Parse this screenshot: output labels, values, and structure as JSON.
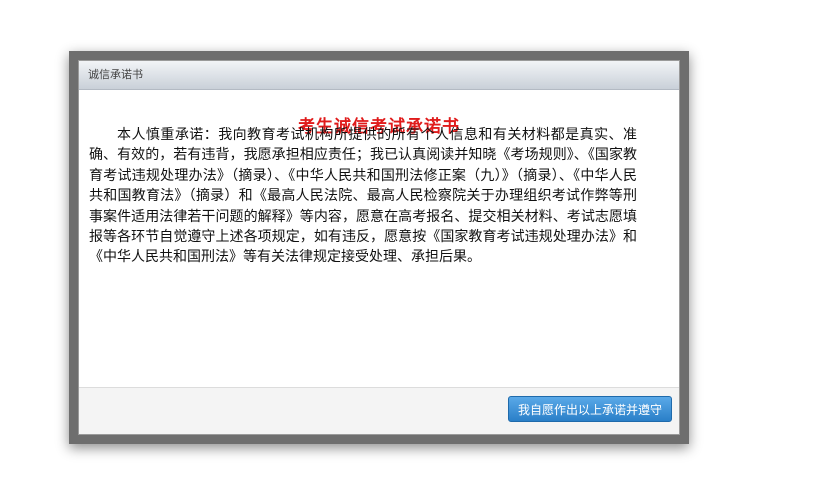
{
  "dialog": {
    "title": "诚信承诺书",
    "heading": "考生诚信考试承诺书",
    "body": "本人慎重承诺：我向教育考试机构所提供的所有个人信息和有关材料都是真实、准确、有效的，若有违背，我愿承担相应责任；我已认真阅读并知晓《考场规则》、《国家教育考试违规处理办法》（摘录）、《中华人民共和国刑法修正案（九）》（摘录）、《中华人民共和国教育法》（摘录）和《最高人民法院、最高人民检察院关于办理组织考试作弊等刑事案件适用法律若干问题的解释》等内容，愿意在高考报名、提交相关材料、考试志愿填报等各环节自觉遵守上述各项规定，如有违反，愿意按《国家教育考试违规处理办法》和《中华人民共和国刑法》等有关法律规定接受处理、承担后果。",
    "agree_button": "我自愿作出以上承诺并遵守"
  }
}
